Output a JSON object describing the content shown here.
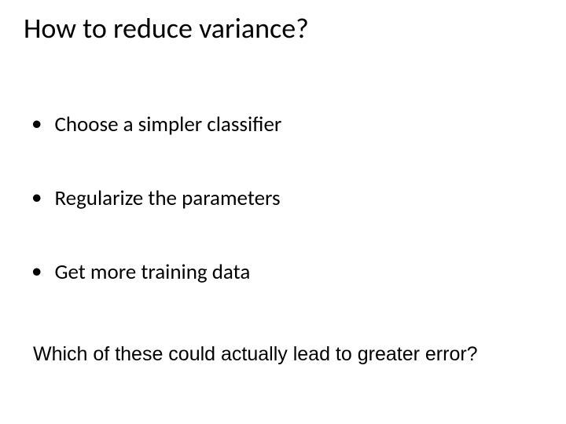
{
  "title": "How to reduce variance?",
  "bullets": [
    "Choose a simpler classifier",
    "Regularize the parameters",
    "Get more training data"
  ],
  "footer_question": "Which of these could actually lead to greater error?"
}
